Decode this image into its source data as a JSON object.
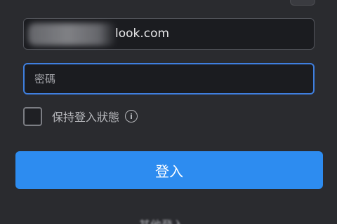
{
  "login": {
    "email_value": "look.com",
    "password_placeholder": "密碼",
    "remember_label": "保持登入狀態",
    "info_icon": "i",
    "submit_label": "登入",
    "bottom_link": "其他登入"
  },
  "colors": {
    "background": "#2a2b2f",
    "field_bg": "#1b1c20",
    "focus_border": "#3f7fdf",
    "primary_button": "#2d8cf0"
  },
  "icons": {
    "corner": "settings-icon",
    "info": "info-icon"
  }
}
